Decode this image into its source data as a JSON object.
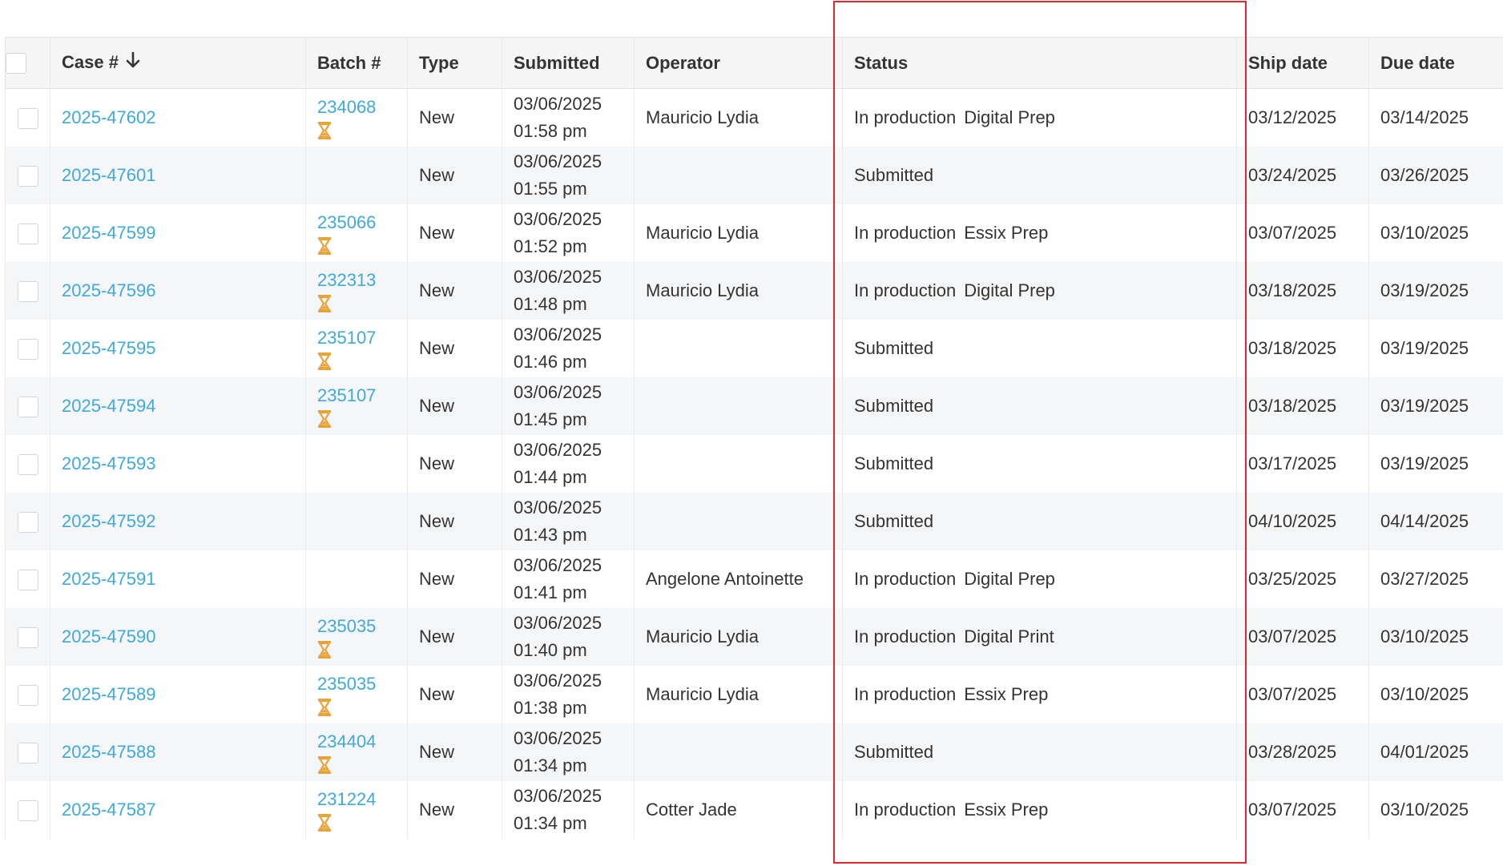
{
  "table": {
    "headers": {
      "case": "Case #",
      "batch": "Batch #",
      "type": "Type",
      "submitted": "Submitted",
      "operator": "Operator",
      "status": "Status",
      "ship_date": "Ship date",
      "due_date": "Due date"
    },
    "sort_icon": "arrow-down-icon",
    "batch_icon": "hourglass-icon",
    "colors": {
      "link": "#3fa9d8",
      "hourglass": "#e8a33a",
      "highlight": "#e0282e"
    },
    "rows": [
      {
        "case": "2025-47602",
        "batch": "234068",
        "type": "New",
        "date": "03/06/2025",
        "time": "01:58 pm",
        "operator": "Mauricio Lydia",
        "status": "In production",
        "status_sub": "Digital Prep",
        "ship": "03/12/2025",
        "due": "03/14/2025"
      },
      {
        "case": "2025-47601",
        "batch": "",
        "type": "New",
        "date": "03/06/2025",
        "time": "01:55 pm",
        "operator": "",
        "status": "Submitted",
        "status_sub": "",
        "ship": "03/24/2025",
        "due": "03/26/2025"
      },
      {
        "case": "2025-47599",
        "batch": "235066",
        "type": "New",
        "date": "03/06/2025",
        "time": "01:52 pm",
        "operator": "Mauricio Lydia",
        "status": "In production",
        "status_sub": "Essix Prep",
        "ship": "03/07/2025",
        "due": "03/10/2025"
      },
      {
        "case": "2025-47596",
        "batch": "232313",
        "type": "New",
        "date": "03/06/2025",
        "time": "01:48 pm",
        "operator": "Mauricio Lydia",
        "status": "In production",
        "status_sub": "Digital Prep",
        "ship": "03/18/2025",
        "due": "03/19/2025"
      },
      {
        "case": "2025-47595",
        "batch": "235107",
        "type": "New",
        "date": "03/06/2025",
        "time": "01:46 pm",
        "operator": "",
        "status": "Submitted",
        "status_sub": "",
        "ship": "03/18/2025",
        "due": "03/19/2025"
      },
      {
        "case": "2025-47594",
        "batch": "235107",
        "type": "New",
        "date": "03/06/2025",
        "time": "01:45 pm",
        "operator": "",
        "status": "Submitted",
        "status_sub": "",
        "ship": "03/18/2025",
        "due": "03/19/2025"
      },
      {
        "case": "2025-47593",
        "batch": "",
        "type": "New",
        "date": "03/06/2025",
        "time": "01:44 pm",
        "operator": "",
        "status": "Submitted",
        "status_sub": "",
        "ship": "03/17/2025",
        "due": "03/19/2025"
      },
      {
        "case": "2025-47592",
        "batch": "",
        "type": "New",
        "date": "03/06/2025",
        "time": "01:43 pm",
        "operator": "",
        "status": "Submitted",
        "status_sub": "",
        "ship": "04/10/2025",
        "due": "04/14/2025"
      },
      {
        "case": "2025-47591",
        "batch": "",
        "type": "New",
        "date": "03/06/2025",
        "time": "01:41 pm",
        "operator": "Angelone Antoinette",
        "status": "In production",
        "status_sub": "Digital Prep",
        "ship": "03/25/2025",
        "due": "03/27/2025"
      },
      {
        "case": "2025-47590",
        "batch": "235035",
        "type": "New",
        "date": "03/06/2025",
        "time": "01:40 pm",
        "operator": "Mauricio Lydia",
        "status": "In production",
        "status_sub": "Digital Print",
        "ship": "03/07/2025",
        "due": "03/10/2025"
      },
      {
        "case": "2025-47589",
        "batch": "235035",
        "type": "New",
        "date": "03/06/2025",
        "time": "01:38 pm",
        "operator": "Mauricio Lydia",
        "status": "In production",
        "status_sub": "Essix Prep",
        "ship": "03/07/2025",
        "due": "03/10/2025"
      },
      {
        "case": "2025-47588",
        "batch": "234404",
        "type": "New",
        "date": "03/06/2025",
        "time": "01:34 pm",
        "operator": "",
        "status": "Submitted",
        "status_sub": "",
        "ship": "03/28/2025",
        "due": "04/01/2025"
      },
      {
        "case": "2025-47587",
        "batch": "231224",
        "type": "New",
        "date": "03/06/2025",
        "time": "01:34 pm",
        "operator": "Cotter Jade",
        "status": "In production",
        "status_sub": "Essix Prep",
        "ship": "03/07/2025",
        "due": "03/10/2025"
      }
    ]
  }
}
